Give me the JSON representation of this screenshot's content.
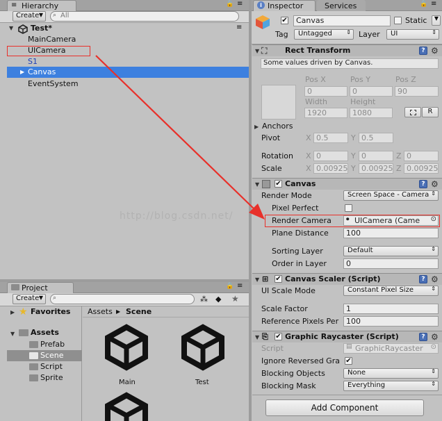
{
  "hierarchy": {
    "tab_label": "Hierarchy",
    "create_label": "Create",
    "search_placeholder": "All",
    "scene_name": "Test*",
    "items": [
      {
        "label": "MainCamera"
      },
      {
        "label": "UICamera"
      },
      {
        "label": "S1"
      },
      {
        "label": "Canvas"
      },
      {
        "label": "EventSystem"
      }
    ]
  },
  "project": {
    "tab_label": "Project",
    "create_label": "Create",
    "favorites_label": "Favorites",
    "assets_label": "Assets",
    "folders": [
      {
        "label": "Prefab"
      },
      {
        "label": "Scene"
      },
      {
        "label": "Script"
      },
      {
        "label": "Sprite"
      }
    ],
    "breadcrumb": {
      "root": "Assets",
      "current": "Scene"
    },
    "files": [
      {
        "label": "Main"
      },
      {
        "label": "Test"
      }
    ]
  },
  "inspector": {
    "tab_label": "Inspector",
    "services_tab_label": "Services",
    "object_name": "Canvas",
    "static_label": "Static",
    "tag_label": "Tag",
    "tag_value": "Untagged",
    "layer_label": "Layer",
    "layer_value": "UI",
    "rect_transform": {
      "title": "Rect Transform",
      "note": "Some values driven by Canvas.",
      "pos_x_label": "Pos X",
      "pos_y_label": "Pos Y",
      "pos_z_label": "Pos Z",
      "pos_x": "0",
      "pos_y": "0",
      "pos_z": "90",
      "width_label": "Width",
      "height_label": "Height",
      "width": "1920",
      "height": "1080",
      "r_button": "R",
      "anchors_label": "Anchors",
      "pivot_label": "Pivot",
      "pivot_x": "0.5",
      "pivot_y": "0.5",
      "rotation_label": "Rotation",
      "rot_x": "0",
      "rot_y": "0",
      "rot_z": "0",
      "scale_label": "Scale",
      "scale_x": "0.00925",
      "scale_y": "0.00925",
      "scale_z": "0.00925",
      "x": "X",
      "y": "Y",
      "z": "Z"
    },
    "canvas": {
      "title": "Canvas",
      "render_mode_label": "Render Mode",
      "render_mode_value": "Screen Space - Camera",
      "pixel_perfect_label": "Pixel Perfect",
      "render_camera_label": "Render Camera",
      "render_camera_value": "UICamera (Came",
      "plane_distance_label": "Plane Distance",
      "plane_distance_value": "100",
      "sorting_layer_label": "Sorting Layer",
      "sorting_layer_value": "Default",
      "order_in_layer_label": "Order in Layer",
      "order_in_layer_value": "0"
    },
    "canvas_scaler": {
      "title": "Canvas Scaler (Script)",
      "ui_scale_mode_label": "UI Scale Mode",
      "ui_scale_mode_value": "Constant Pixel Size",
      "scale_factor_label": "Scale Factor",
      "scale_factor_value": "1",
      "ref_pixels_label": "Reference Pixels Per",
      "ref_pixels_value": "100"
    },
    "graphic_raycaster": {
      "title": "Graphic Raycaster (Script)",
      "script_label": "Script",
      "script_value": "GraphicRaycaster",
      "ignore_reversed_label": "Ignore Reversed Gra",
      "blocking_objects_label": "Blocking Objects",
      "blocking_objects_value": "None",
      "blocking_mask_label": "Blocking Mask",
      "blocking_mask_value": "Everything"
    },
    "add_component_label": "Add Component"
  },
  "watermark": "http://blog.csdn.net/",
  "colors": {
    "selection": "#3d80df",
    "annotation": "#e8302a"
  }
}
